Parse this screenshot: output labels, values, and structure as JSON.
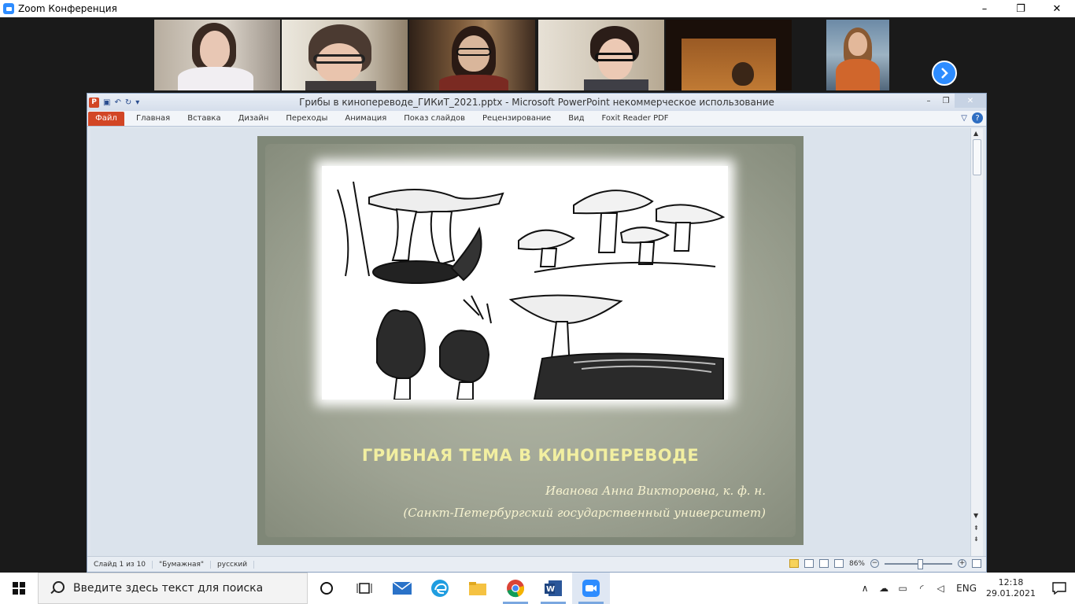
{
  "zoom": {
    "title": "Zoom Конференция",
    "window_controls": [
      "–",
      "❐",
      "✕"
    ],
    "participants_count_visible": 6,
    "next_page_icon": "chevron-right-icon"
  },
  "powerpoint": {
    "title": "Грибы в кинопереводе_ГИКиТ_2021.pptx  -  Microsoft PowerPoint некоммерческое использование",
    "file_tab": "Файл",
    "tabs": [
      "Главная",
      "Вставка",
      "Дизайн",
      "Переходы",
      "Анимация",
      "Показ слайдов",
      "Рецензирование",
      "Вид",
      "Foxit Reader PDF"
    ],
    "help_label": "?",
    "slide": {
      "title": "ГРИБНАЯ ТЕМА В КИНОПЕРЕВОДЕ",
      "author": "Иванова Анна Викторовна, к. ф. н.",
      "affiliation": "(Санкт-Петербургский государственный университет)"
    },
    "status": {
      "slide_info": "Слайд 1 из 10",
      "theme": "\"Бумажная\"",
      "language": "русский",
      "zoom": "86%"
    }
  },
  "taskbar": {
    "search_placeholder": "Введите здесь текст для поиска",
    "language": "ENG",
    "time": "12:18",
    "date": "29.01.2021"
  },
  "colors": {
    "zoom_blue": "#2d8cff",
    "ppt_orange": "#d24625",
    "slide_title": "#f2efa1",
    "active_speaker": "#a6d73a"
  }
}
